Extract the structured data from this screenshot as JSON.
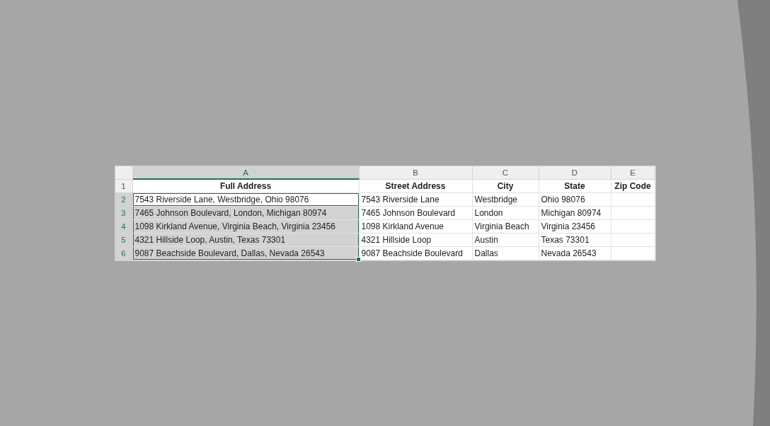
{
  "sheet": {
    "columns": [
      {
        "label": "A",
        "selected": true
      },
      {
        "label": "B",
        "selected": false
      },
      {
        "label": "C",
        "selected": false
      },
      {
        "label": "D",
        "selected": false
      },
      {
        "label": "E",
        "selected": false
      }
    ],
    "rows": [
      {
        "number": "1",
        "selected": false,
        "cells": [
          {
            "text": "Full Address",
            "selected": false,
            "active": false
          },
          {
            "text": "Street Address",
            "selected": false,
            "active": false
          },
          {
            "text": "City",
            "selected": false,
            "active": false
          },
          {
            "text": "State",
            "selected": false,
            "active": false
          },
          {
            "text": "Zip Code",
            "selected": false,
            "active": false
          }
        ]
      },
      {
        "number": "2",
        "selected": true,
        "cells": [
          {
            "text": "7543 Riverside Lane, Westbridge, Ohio 98076",
            "selected": true,
            "active": true
          },
          {
            "text": "7543 Riverside Lane",
            "selected": false,
            "active": false
          },
          {
            "text": "Westbridge",
            "selected": false,
            "active": false
          },
          {
            "text": "Ohio 98076",
            "selected": false,
            "active": false
          },
          {
            "selected": false,
            "active": false
          }
        ]
      },
      {
        "number": "3",
        "selected": true,
        "cells": [
          {
            "text": "7465 Johnson Boulevard, London, Michigan 80974",
            "selected": true,
            "active": false
          },
          {
            "text": "7465 Johnson Boulevard",
            "selected": false,
            "active": false
          },
          {
            "text": "London",
            "selected": false,
            "active": false
          },
          {
            "text": "Michigan 80974",
            "selected": false,
            "active": false
          },
          {
            "selected": false,
            "active": false
          }
        ]
      },
      {
        "number": "4",
        "selected": true,
        "cells": [
          {
            "text": "1098 Kirkland Avenue, Virginia Beach, Virginia 23456",
            "selected": true,
            "active": false
          },
          {
            "text": "1098 Kirkland Avenue",
            "selected": false,
            "active": false
          },
          {
            "text": "Virginia Beach",
            "selected": false,
            "active": false
          },
          {
            "text": "Virginia 23456",
            "selected": false,
            "active": false
          },
          {
            "selected": false,
            "active": false
          }
        ]
      },
      {
        "number": "5",
        "selected": true,
        "cells": [
          {
            "text": "4321 Hillside Loop, Austin, Texas 73301",
            "selected": true,
            "active": false
          },
          {
            "text": "4321 Hillside Loop",
            "selected": false,
            "active": false
          },
          {
            "text": "Austin",
            "selected": false,
            "active": false
          },
          {
            "text": "Texas 73301",
            "selected": false,
            "active": false
          },
          {
            "selected": false,
            "active": false
          }
        ]
      },
      {
        "number": "6",
        "selected": true,
        "cells": [
          {
            "text": "9087 Beachside Boulevard, Dallas, Nevada 26543",
            "selected": true,
            "active": false
          },
          {
            "text": "9087 Beachside Boulevard",
            "selected": false,
            "active": false
          },
          {
            "text": "Dallas",
            "selected": false,
            "active": false
          },
          {
            "text": "Nevada 26543",
            "selected": false,
            "active": false
          },
          {
            "selected": false,
            "active": false
          }
        ]
      }
    ]
  }
}
